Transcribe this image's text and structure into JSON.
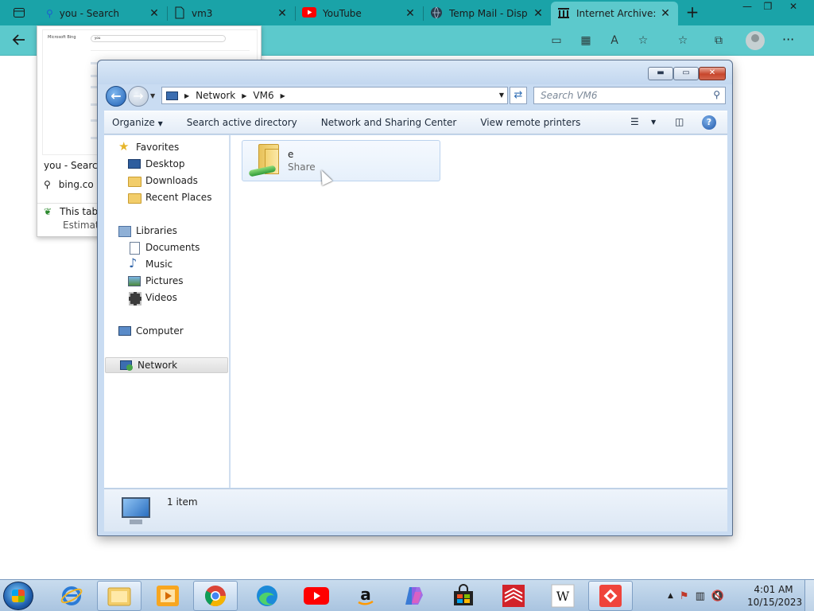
{
  "browser": {
    "tabs": [
      {
        "title": "you - Search",
        "icon": "search-icon"
      },
      {
        "title": "vm3",
        "icon": "page-icon"
      },
      {
        "title": "YouTube",
        "icon": "youtube-icon"
      },
      {
        "title": "Temp Mail - Disp",
        "icon": "globe-icon"
      },
      {
        "title": "Internet Archive: D",
        "icon": "archive-icon"
      }
    ],
    "active_tab_index": 4,
    "accent_color": "#1aa3a8",
    "toolbar_icons": [
      "app-available-icon",
      "apps-icon",
      "read-aloud-icon",
      "add-favorite-icon",
      "favorites-icon",
      "collections-icon",
      "profile-icon",
      "more-icon"
    ]
  },
  "preview": {
    "tab_title": "you - Search",
    "url": "bing.co",
    "tab_status": "This tab",
    "estimate": "Estimate",
    "thumb_logo": "Microsoft Bing",
    "thumb_query": "you"
  },
  "explorer": {
    "breadcrumb": [
      "Network",
      "VM6"
    ],
    "search_placeholder": "Search VM6",
    "commands": [
      "Organize",
      "Search active directory",
      "Network and Sharing Center",
      "View remote printers"
    ],
    "nav": {
      "favorites": {
        "label": "Favorites",
        "items": [
          "Desktop",
          "Downloads",
          "Recent Places"
        ]
      },
      "libraries": {
        "label": "Libraries",
        "items": [
          "Documents",
          "Music",
          "Pictures",
          "Videos"
        ]
      },
      "computer": "Computer",
      "network": "Network"
    },
    "item": {
      "name": "e",
      "type": "Share"
    },
    "status": "1 item"
  },
  "taskbar": {
    "apps": [
      "internet-explorer",
      "windows-explorer",
      "media-player",
      "chrome",
      "edge",
      "youtube",
      "amazon",
      "copilot",
      "store",
      "bank-of-america",
      "wikipedia",
      "anydesk"
    ],
    "time": "4:01 AM",
    "date": "10/15/2023"
  }
}
